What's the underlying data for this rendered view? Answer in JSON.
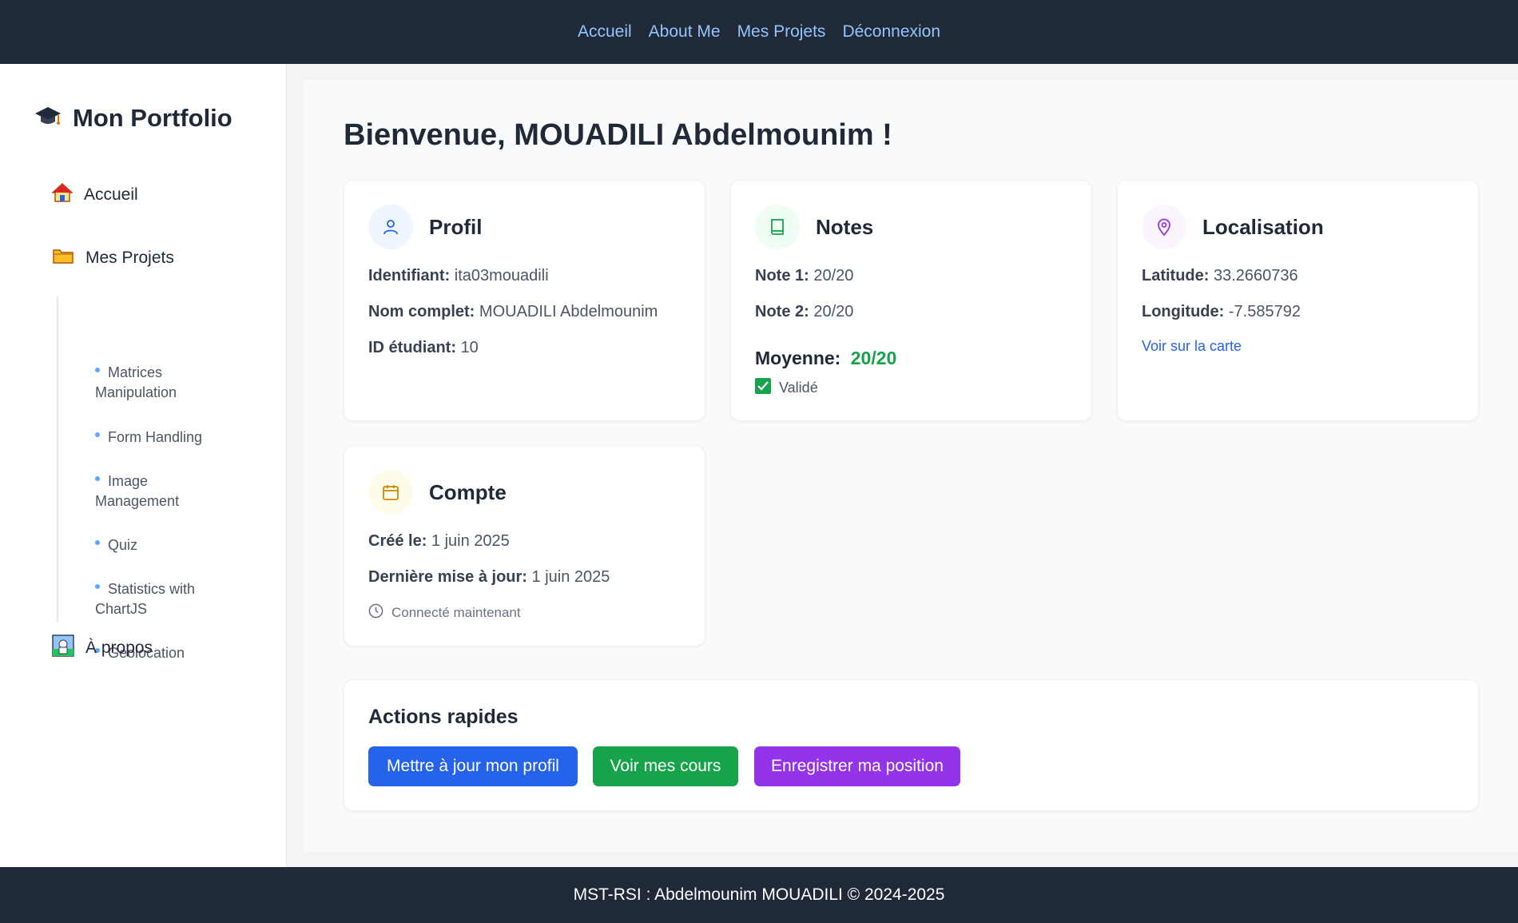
{
  "topnav": {
    "links": [
      "Accueil",
      "About Me",
      "Mes Projets",
      "Déconnexion"
    ],
    "link_color": "#93c5fd",
    "bg_color": "#1f2937"
  },
  "sidebar": {
    "brand_icon": "graduation-cap-icon",
    "brand_title": "Mon Portfolio",
    "items": [
      {
        "label": "Accueil",
        "icon": "house-icon"
      },
      {
        "label": "Mes Projets",
        "icon": "folder-icon"
      },
      {
        "label": "À propos",
        "icon": "picture-icon"
      }
    ],
    "subitems": [
      "Matrices Manipulation",
      "Form Handling",
      "Image Management",
      "Quiz",
      "Statistics with ChartJS",
      "Geolocation"
    ]
  },
  "main": {
    "welcome": "Bienvenue, MOUADILI Abdelmounim !",
    "profil": {
      "title": "Profil",
      "icon": "user-icon",
      "rows": [
        {
          "label": "Identifiant:",
          "value": "ita03mouadili"
        },
        {
          "label": "Nom complet:",
          "value": "MOUADILI Abdelmounim"
        },
        {
          "label": "ID étudiant:",
          "value": "10"
        }
      ]
    },
    "notes": {
      "title": "Notes",
      "icon": "book-icon",
      "rows": [
        {
          "label": "Note 1:",
          "value": "20/20"
        },
        {
          "label": "Note 2:",
          "value": "20/20"
        }
      ],
      "average_label": "Moyenne:",
      "average_value": "20/20",
      "status": "Validé",
      "status_icon": "check-box-icon",
      "accent": "#16a34a"
    },
    "localisation": {
      "title": "Localisation",
      "icon": "map-pin-icon",
      "rows": [
        {
          "label": "Latitude:",
          "value": "33.2660736"
        },
        {
          "label": "Longitude:",
          "value": "-7.585792"
        }
      ],
      "link": "Voir sur la carte"
    },
    "compte": {
      "title": "Compte",
      "icon": "calendar-icon",
      "rows": [
        {
          "label": "Créé le:",
          "value": "1 juin 2025"
        },
        {
          "label": "Dernière mise à jour:",
          "value": "1 juin 2025"
        }
      ],
      "status": "Connecté maintenant",
      "status_icon": "clock-icon"
    },
    "actions": {
      "title": "Actions rapides",
      "buttons": [
        {
          "label": "Mettre à jour mon profil",
          "color": "#2563eb"
        },
        {
          "label": "Voir mes cours",
          "color": "#16a34a"
        },
        {
          "label": "Enregistrer ma position",
          "color": "#9333ea"
        }
      ]
    }
  },
  "footer": {
    "text": "MST-RSI : Abdelmounim MOUADILI © 2024-2025"
  }
}
